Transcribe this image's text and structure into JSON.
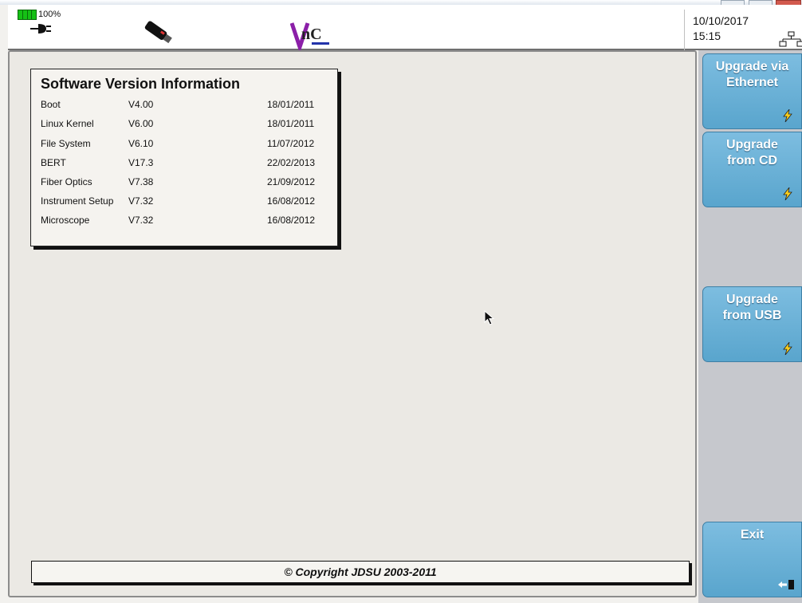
{
  "status": {
    "battery_percent": "100%",
    "date": "10/10/2017",
    "time": "15:15",
    "icons": [
      "battery-icon",
      "power-plug-icon",
      "usb-stick-icon",
      "app-logo-icon",
      "network-icon"
    ]
  },
  "software_info": {
    "title": "Software Version Information",
    "rows": [
      {
        "name": "Boot",
        "version": "V4.00",
        "date": "18/01/2011"
      },
      {
        "name": "Linux Kernel",
        "version": "V6.00",
        "date": "18/01/2011"
      },
      {
        "name": "File System",
        "version": "V6.10",
        "date": "11/07/2012"
      },
      {
        "name": "BERT",
        "version": "V17.3",
        "date": "22/02/2013"
      },
      {
        "name": "Fiber Optics",
        "version": "V7.38",
        "date": "21/09/2012"
      },
      {
        "name": "Instrument Setup",
        "version": "V7.32",
        "date": "16/08/2012"
      },
      {
        "name": "Microscope",
        "version": "V7.32",
        "date": "16/08/2012"
      }
    ]
  },
  "footer": {
    "copyright": "© Copyright JDSU 2003-2011"
  },
  "sidebar": {
    "buttons": [
      {
        "label": "Upgrade via\nEthernet",
        "icon": "lightning-icon"
      },
      {
        "label": "Upgrade\nfrom CD",
        "icon": "lightning-icon"
      },
      {
        "label": "Upgrade\nfrom USB",
        "icon": "lightning-icon"
      },
      {
        "label": "Exit",
        "icon": "exit-arrow-icon"
      }
    ]
  },
  "colors": {
    "button": "#6cb1d8",
    "panel": "#ebe9e4",
    "sidebar": "#c6c8cd",
    "battery": "#15c015"
  }
}
